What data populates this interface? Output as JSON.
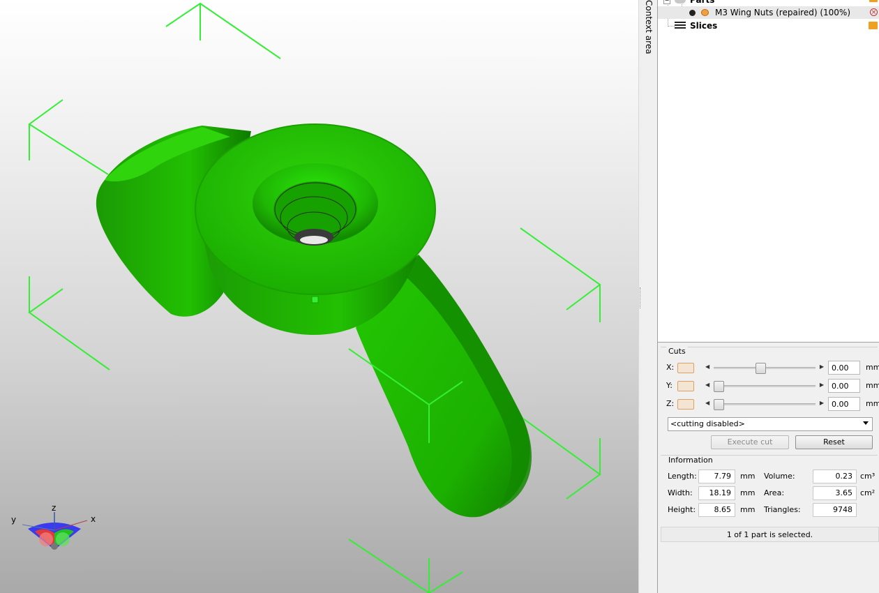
{
  "context_area": {
    "label": "Context area"
  },
  "tree": {
    "parts_label": "Parts",
    "item_label": "M3 Wing Nuts (repaired) (100%)",
    "slices_label": "Slices"
  },
  "cuts": {
    "title": "Cuts",
    "rows": [
      {
        "axis": "X:",
        "value": "0.00",
        "unit": "mm",
        "slider_fraction": 0.5
      },
      {
        "axis": "Y:",
        "value": "0.00",
        "unit": "mm",
        "slider_fraction": 0.0
      },
      {
        "axis": "Z:",
        "value": "0.00",
        "unit": "mm",
        "slider_fraction": 0.0
      }
    ],
    "select_value": "<cutting disabled>",
    "execute_label": "Execute cut",
    "reset_label": "Reset"
  },
  "information": {
    "title": "Information",
    "length_label": "Length:",
    "length_value": "7.79",
    "length_unit": "mm",
    "width_label": "Width:",
    "width_value": "18.19",
    "width_unit": "mm",
    "height_label": "Height:",
    "height_value": "8.65",
    "height_unit": "mm",
    "volume_label": "Volume:",
    "volume_value": "0.23",
    "volume_unit": "cm³",
    "area_label": "Area:",
    "area_value": "3.65",
    "area_unit": "cm²",
    "triangles_label": "Triangles:",
    "triangles_value": "9748"
  },
  "status": "1 of 1 part is selected.",
  "axis_gizmo": {
    "x": "x",
    "y": "y",
    "z": "z"
  },
  "colors": {
    "model": "#22cc00",
    "bbox": "#33ee33",
    "accent": "#e09050"
  }
}
